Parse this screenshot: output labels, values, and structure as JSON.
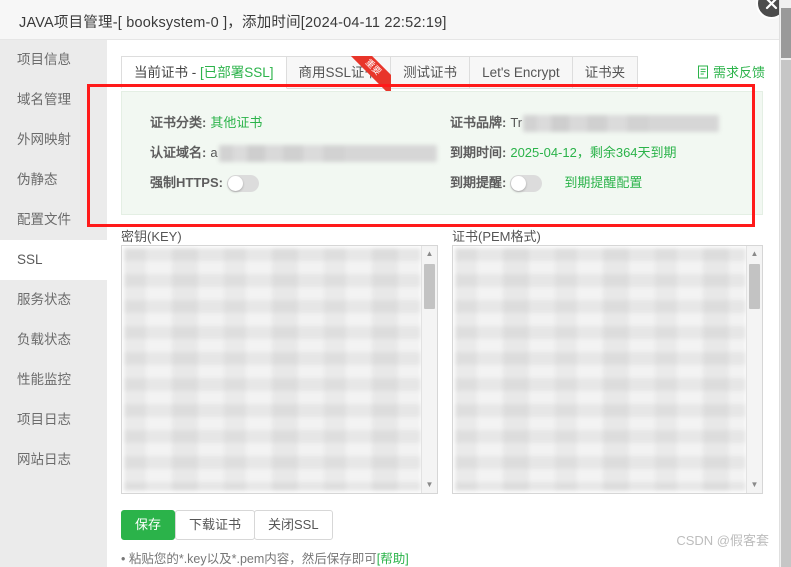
{
  "window": {
    "title": "JAVA项目管理-[ booksystem-0 ]，添加时间[2024-04-11 22:52:19]",
    "close_icon": "close-icon"
  },
  "sidebar": {
    "items": [
      {
        "label": "项目信息",
        "active": false
      },
      {
        "label": "域名管理",
        "active": false
      },
      {
        "label": "外网映射",
        "active": false
      },
      {
        "label": "伪静态",
        "active": false
      },
      {
        "label": "配置文件",
        "active": false
      },
      {
        "label": "SSL",
        "active": true
      },
      {
        "label": "服务状态",
        "active": false
      },
      {
        "label": "负载状态",
        "active": false
      },
      {
        "label": "性能监控",
        "active": false
      },
      {
        "label": "项目日志",
        "active": false
      },
      {
        "label": "网站日志",
        "active": false
      }
    ]
  },
  "tabs": [
    {
      "label": "当前证书 - ",
      "status": "[已部署SSL]",
      "active": true,
      "ribbon": ""
    },
    {
      "label": "商用SSL证书",
      "status": "",
      "active": false,
      "ribbon": "重要"
    },
    {
      "label": "测试证书",
      "status": "",
      "active": false,
      "ribbon": ""
    },
    {
      "label": "Let's Encrypt",
      "status": "",
      "active": false,
      "ribbon": ""
    },
    {
      "label": "证书夹",
      "status": "",
      "active": false,
      "ribbon": ""
    }
  ],
  "feedback": {
    "label": "需求反馈",
    "icon": "document-feedback-icon"
  },
  "cert_info": {
    "left": [
      {
        "label": "证书分类:",
        "value": "其他证书",
        "style": "green",
        "type": "text"
      },
      {
        "label": "认证域名:",
        "value": "a",
        "style": "plain",
        "type": "masked"
      },
      {
        "label": "强制HTTPS:",
        "value": "",
        "style": "plain",
        "type": "switch",
        "switch_on": false
      }
    ],
    "right": [
      {
        "label": "证书品牌:",
        "value": "Tr",
        "style": "plain",
        "type": "masked"
      },
      {
        "label": "到期时间:",
        "value": "2025-04-12，剩余364天到期",
        "style": "green",
        "type": "text"
      },
      {
        "label": "到期提醒:",
        "value": "",
        "style": "plain",
        "type": "switch",
        "switch_on": false,
        "link": "到期提醒配置"
      }
    ]
  },
  "editors": [
    {
      "label": "密钥(KEY)",
      "content": ""
    },
    {
      "label": "证书(PEM格式)",
      "content": ""
    }
  ],
  "buttons": [
    {
      "label": "保存",
      "kind": "primary"
    },
    {
      "label": "下载证书",
      "kind": "default"
    },
    {
      "label": "关闭SSL",
      "kind": "default"
    }
  ],
  "note": {
    "text": "• 粘贴您的*.key以及*.pem内容，然后保存即可",
    "help": "[帮助]"
  },
  "watermark": "CSDN @假客套",
  "colors": {
    "accent_green": "#2bb34a",
    "annotation_red": "#ff1a1a",
    "ribbon_red": "#e8352a",
    "panel_bg": "#f2f8f2",
    "sidebar_bg": "#ebebeb"
  }
}
